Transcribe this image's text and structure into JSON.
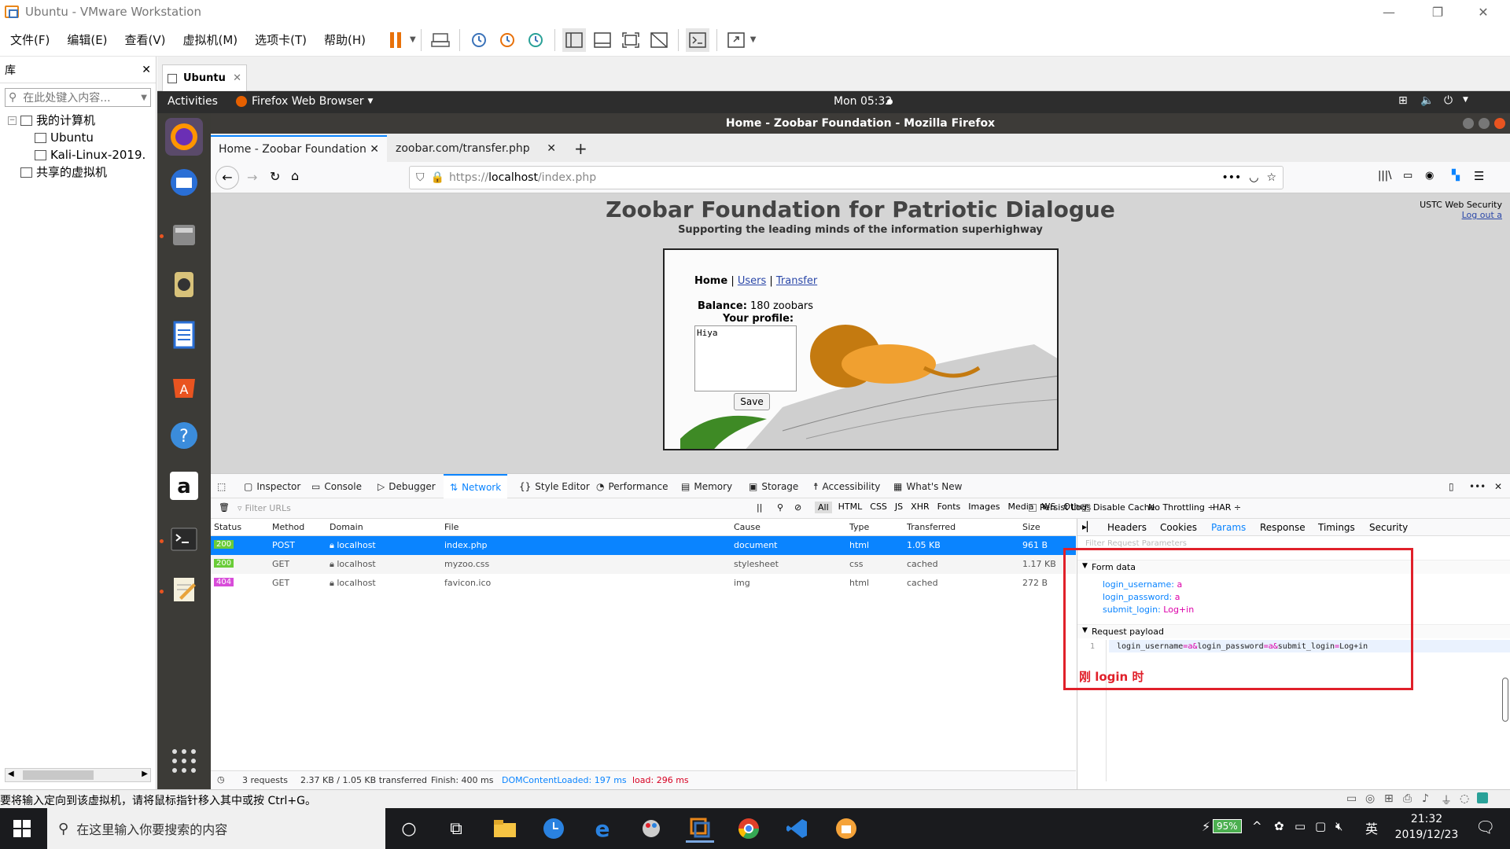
{
  "vmware": {
    "title": "Ubuntu - VMware Workstation",
    "menu": [
      "文件(F)",
      "编辑(E)",
      "查看(V)",
      "虚拟机(M)",
      "选项卡(T)",
      "帮助(H)"
    ],
    "library_title": "库",
    "library_search_placeholder": "在此处键入内容...",
    "tree": [
      "我的计算机",
      "Ubuntu",
      "Kali-Linux-2019.",
      "共享的虚拟机"
    ],
    "vm_tab": "Ubuntu",
    "status_text": "要将输入定向到该虚拟机，请将鼠标指针移入其中或按 Ctrl+G。"
  },
  "gnome": {
    "activities": "Activities",
    "app_name": "Firefox Web Browser",
    "clock": "Mon 05:32"
  },
  "firefox": {
    "window_title": "Home - Zoobar Foundation - Mozilla Firefox",
    "tabs": [
      {
        "title": "Home - Zoobar Foundation"
      },
      {
        "title": "zoobar.com/transfer.php"
      }
    ],
    "url_prefix": "https://",
    "url_host": "localhost",
    "url_path": "/index.php"
  },
  "zoobar": {
    "title": "Zoobar Foundation for Patriotic Dialogue",
    "subtitle": "Supporting the leading minds of the information superhighway",
    "corner_text": "USTC Web Security",
    "logout": "Log out a",
    "nav": {
      "home": "Home",
      "sep": " | ",
      "users": "Users",
      "transfer": "Transfer"
    },
    "balance_label": "Balance:",
    "balance_value": " 180 zoobars",
    "profile_label": "Your profile:",
    "profile_text": "Hiya",
    "save": "Save"
  },
  "devtools": {
    "tabs": [
      "Inspector",
      "Console",
      "Debugger",
      "Network",
      "Style Editor",
      "Performance",
      "Memory",
      "Storage",
      "Accessibility",
      "What's New"
    ],
    "active_tab": "Network",
    "filter_placeholder": "Filter URLs",
    "type_filters": [
      "All",
      "HTML",
      "CSS",
      "JS",
      "XHR",
      "Fonts",
      "Images",
      "Media",
      "WS",
      "Other"
    ],
    "persist_logs": "Persist Logs",
    "disable_cache": "Disable Cache",
    "throttling": "No Throttling ÷",
    "har": "HAR ÷",
    "columns": [
      "Status",
      "Method",
      "Domain",
      "File",
      "Cause",
      "Type",
      "Transferred",
      "Size"
    ],
    "rows": [
      {
        "status": "200",
        "method": "POST",
        "domain": "localhost",
        "file": "index.php",
        "cause": "document",
        "type": "html",
        "transferred": "1.05 KB",
        "size": "961 B",
        "status_color": "#6acc38"
      },
      {
        "status": "200",
        "method": "GET",
        "domain": "localhost",
        "file": "myzoo.css",
        "cause": "stylesheet",
        "type": "css",
        "transferred": "cached",
        "size": "1.17 KB",
        "status_color": "#6acc38"
      },
      {
        "status": "404",
        "method": "GET",
        "domain": "localhost",
        "file": "favicon.ico",
        "cause": "img",
        "type": "html",
        "transferred": "cached",
        "size": "272 B",
        "status_color": "#d84cd9"
      }
    ],
    "summary": {
      "requests": "3 requests",
      "transferred": "2.37 KB / 1.05 KB transferred",
      "finish": "Finish: 400 ms",
      "dom": "DOMContentLoaded: 197 ms",
      "load": "load: 296 ms"
    },
    "side_tabs": [
      "Headers",
      "Cookies",
      "Params",
      "Response",
      "Timings",
      "Security"
    ],
    "active_side_tab": "Params",
    "filter_params": "Filter Request Parameters",
    "form_data_title": "Form data",
    "form_data": [
      {
        "key": "login_username",
        "value": "a"
      },
      {
        "key": "login_password",
        "value": "a"
      },
      {
        "key": "submit_login",
        "value": "Log+in"
      }
    ],
    "payload_title": "Request payload",
    "payload_line": "1",
    "payload_parts": [
      "login_username",
      "=",
      "a",
      "&",
      "login_password",
      "=",
      "a",
      "&",
      "submit_login",
      "=",
      "Log+in"
    ],
    "annotation": "刚 login 时"
  },
  "taskbar": {
    "search_placeholder": "在这里输入你要搜索的内容",
    "battery": "95%",
    "ime": "英",
    "time": "21:32",
    "date": "2019/12/23"
  },
  "colors": {
    "accent_blue": "#0a84ff",
    "selection": "#0a84ff",
    "annotation_red": "#e0202a",
    "ubuntu_orange": "#e95420"
  }
}
